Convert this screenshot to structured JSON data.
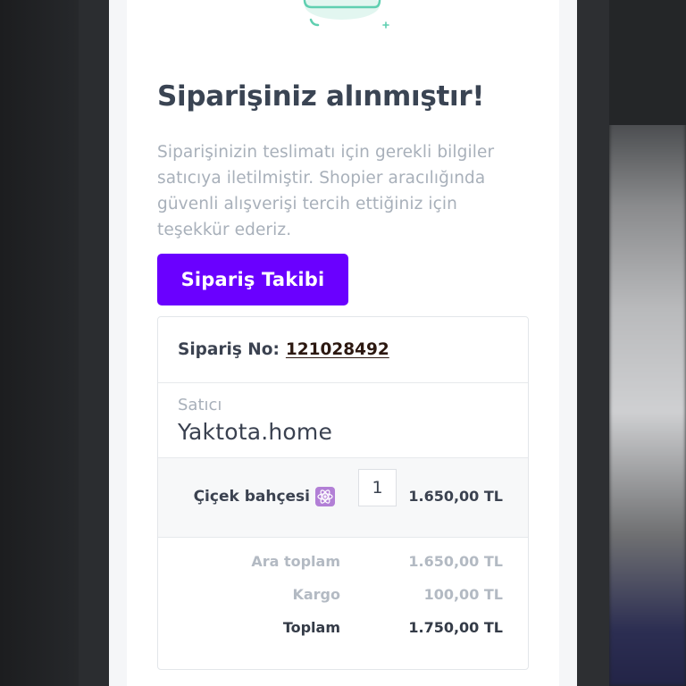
{
  "title": "Siparişiniz alınmıştır!",
  "description": "Siparişinizin teslimatı için gerekli bilgiler satıcıya iletilmiştir. Shopier aracılığında güvenli alışverişi tercih ettiğiniz için teşekkür ederiz.",
  "track_button_label": "Sipariş Takibi",
  "order": {
    "label": "Sipariş No:",
    "number": "121028492"
  },
  "seller": {
    "label": "Satıcı",
    "name": "Yaktota.home"
  },
  "item": {
    "name": "Çiçek bahçesi",
    "icon": "atom-icon",
    "quantity": "1",
    "price": "1.650,00 TL"
  },
  "totals": {
    "subtotal_label": "Ara toplam",
    "subtotal_value": "1.650,00 TL",
    "shipping_label": "Kargo",
    "shipping_value": "100,00 TL",
    "total_label": "Toplam",
    "total_value": "1.750,00 TL"
  },
  "colors": {
    "accent": "#6a00ff",
    "title": "#3a4453",
    "muted": "#a8b0ba",
    "illustration": "#5fcfb0"
  }
}
